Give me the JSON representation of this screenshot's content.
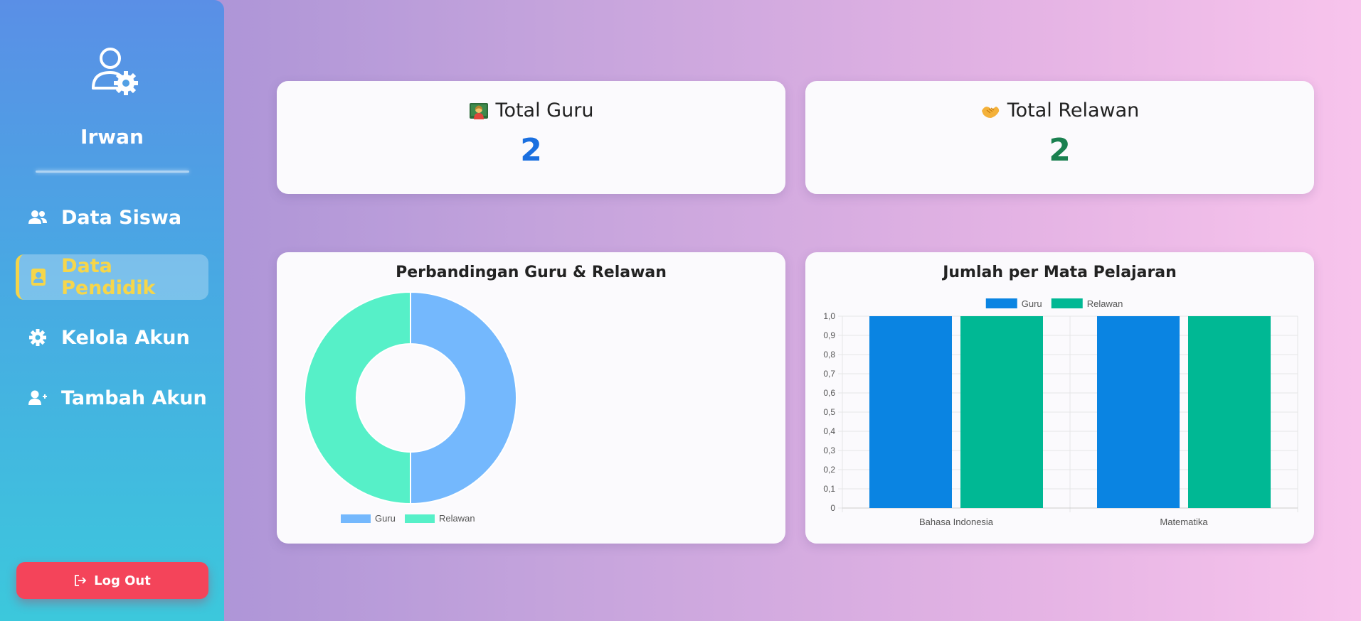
{
  "sidebar": {
    "username": "Irwan",
    "nav": [
      {
        "label": "Data Siswa",
        "icon": "users-icon"
      },
      {
        "label": "Data Pendidik",
        "icon": "contact-book-icon",
        "active": true
      },
      {
        "label": "Kelola Akun",
        "icon": "gear-icon"
      },
      {
        "label": "Tambah Akun",
        "icon": "user-plus-icon"
      }
    ],
    "logout_label": "Log Out"
  },
  "stats": {
    "guru": {
      "title": "Total Guru",
      "value": "2",
      "color": "#1a6fe0"
    },
    "relawan": {
      "title": "Total Relawan",
      "value": "2",
      "color": "#1a8050"
    }
  },
  "colors": {
    "accent_yellow": "#f4d44a",
    "logout": "#f4445a",
    "donut_guru": "#74b8fd",
    "donut_relawan": "#56f0c8",
    "bar_guru": "#0a84e2",
    "bar_relawan": "#00b894"
  },
  "chart_data": [
    {
      "type": "pie",
      "title": "Perbandingan Guru & Relawan",
      "categories": [
        "Guru",
        "Relawan"
      ],
      "values": [
        2,
        2
      ],
      "legend": "bottom"
    },
    {
      "type": "bar",
      "title": "Jumlah per Mata Pelajaran",
      "categories": [
        "Bahasa Indonesia",
        "Matematika"
      ],
      "series": [
        {
          "name": "Guru",
          "values": [
            1,
            1
          ]
        },
        {
          "name": "Relawan",
          "values": [
            1,
            1
          ]
        }
      ],
      "ylim": [
        0,
        1
      ],
      "yticks": [
        "0",
        "0,1",
        "0,2",
        "0,3",
        "0,4",
        "0,5",
        "0,6",
        "0,7",
        "0,8",
        "0,9",
        "1,0"
      ],
      "grid": true,
      "legend": "top"
    }
  ]
}
